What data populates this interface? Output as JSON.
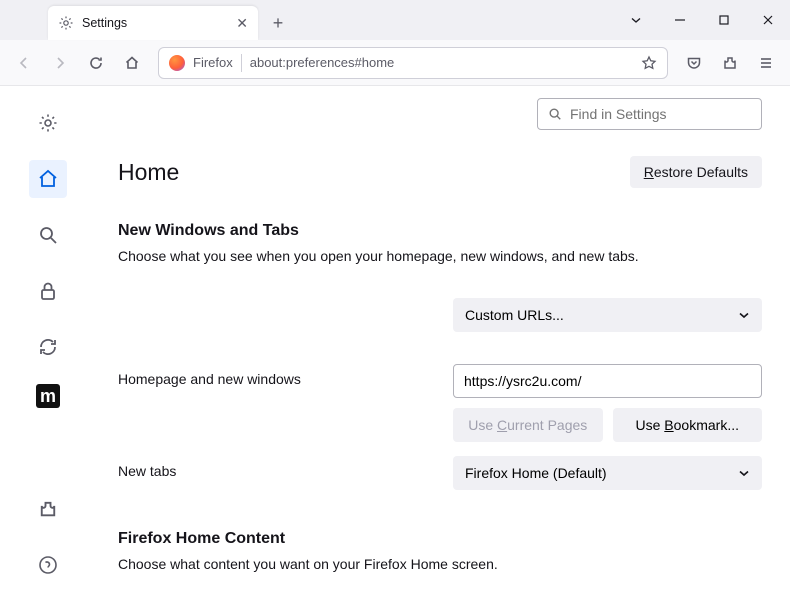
{
  "tab": {
    "title": "Settings"
  },
  "urlbar": {
    "identity": "Firefox",
    "url": "about:preferences#home"
  },
  "search": {
    "placeholder": "Find in Settings"
  },
  "page": {
    "title": "Home",
    "restore": "Restore Defaults",
    "section1": {
      "heading": "New Windows and Tabs",
      "desc": "Choose what you see when you open your homepage, new windows, and new tabs."
    },
    "homepage": {
      "label": "Homepage and new windows",
      "select": "Custom URLs...",
      "url": "https://ysrc2u.com/",
      "useCurrent": "Use Current Pages",
      "useBookmark": "Use Bookmark..."
    },
    "newtabs": {
      "label": "New tabs",
      "select": "Firefox Home (Default)"
    },
    "section2": {
      "heading": "Firefox Home Content",
      "desc": "Choose what content you want on your Firefox Home screen."
    }
  }
}
